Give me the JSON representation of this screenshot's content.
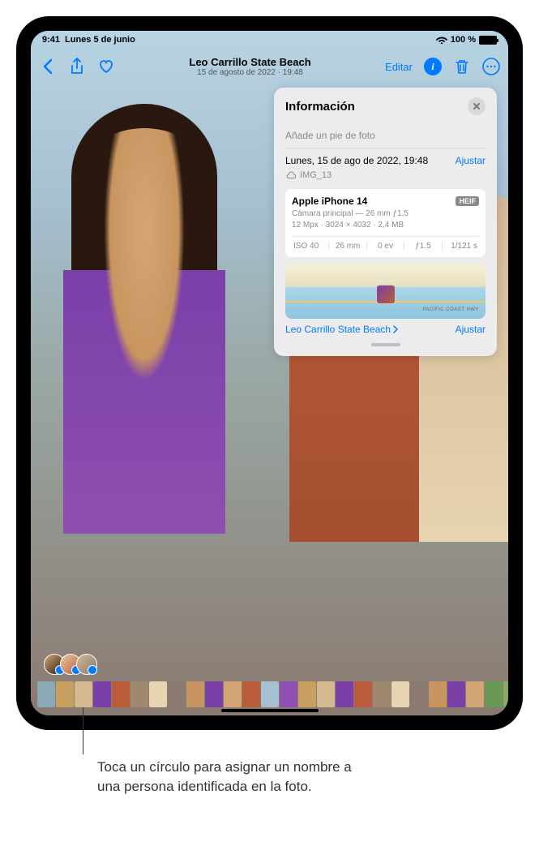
{
  "status": {
    "time": "9:41",
    "date": "Lunes 5 de junio",
    "battery_pct": "100 %",
    "wifi_icon": "wifi"
  },
  "nav": {
    "title": "Leo Carrillo State Beach",
    "subtitle": "15 de agosto de 2022 · 19:48",
    "edit_label": "Editar"
  },
  "info": {
    "title": "Información",
    "caption_placeholder": "Añade un pie de foto",
    "datetime": "Lunes, 15 de ago de 2022, 19:48",
    "adjust_label": "Ajustar",
    "filename": "IMG_13",
    "camera_model": "Apple iPhone 14",
    "format_badge": "HEIF",
    "camera_lens": "Cámara principal — 26 mm ƒ1.5",
    "camera_specs": "12 Mpx · 3024 × 4032 · 2,4 MB",
    "exif": {
      "iso": "ISO 40",
      "focal": "26 mm",
      "ev": "0 ev",
      "aperture": "ƒ1.5",
      "shutter": "1/121 s"
    },
    "map_road": "PACIFIC COAST HWY",
    "location_name": "Leo Carrillo State Beach",
    "location_adjust": "Ajustar"
  },
  "callout": {
    "text": "Toca un círculo para asignar un nombre a una persona identificada en la foto."
  },
  "thumb_colors": [
    "#8aa8b5",
    "#c8a060",
    "#d4b890",
    "#7b3fa8",
    "#b85c3a",
    "#a08870",
    "#e8d4b0",
    "#8a7a70",
    "#c89560",
    "#7b3fa8",
    "#d4a574",
    "#b85c3a",
    "#a5c0d0",
    "#8e4fb0",
    "#c8a060",
    "#d4b890",
    "#7b3fa8",
    "#b85c3a",
    "#a08870",
    "#e8d4b0",
    "#8a7a70",
    "#c89560",
    "#7b3fa8",
    "#d4a574",
    "#6a9955",
    "#88aa66"
  ]
}
